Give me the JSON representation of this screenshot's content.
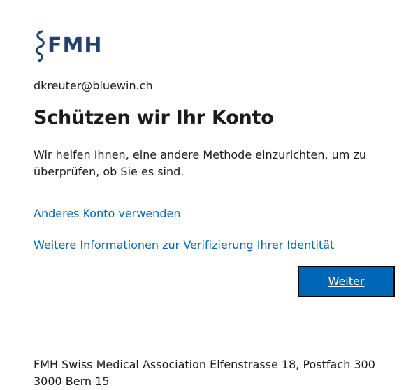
{
  "brand": {
    "logo_text": "FMH",
    "logo_color": "#24406e",
    "logo_icon": "serpent-staff-icon"
  },
  "account": {
    "email": "dkreuter@bluewin.ch"
  },
  "main": {
    "title": "Schützen wir Ihr Konto",
    "description": "Wir helfen Ihnen, eine andere Methode einzurichten, um zu überprüfen, ob Sie es sind.",
    "link_other_account": "Anderes Konto verwenden",
    "link_more_info": "Weitere Informationen zur Verifizierung Ihrer Identität",
    "next_button": "Weiter"
  },
  "footer": {
    "line1": "FMH Swiss Medical Association Elfenstrasse 18, Postfach 300",
    "line2": "3000 Bern 15"
  },
  "colors": {
    "accent": "#0067b8",
    "link": "#0067b8",
    "text": "#1b1b1b"
  }
}
